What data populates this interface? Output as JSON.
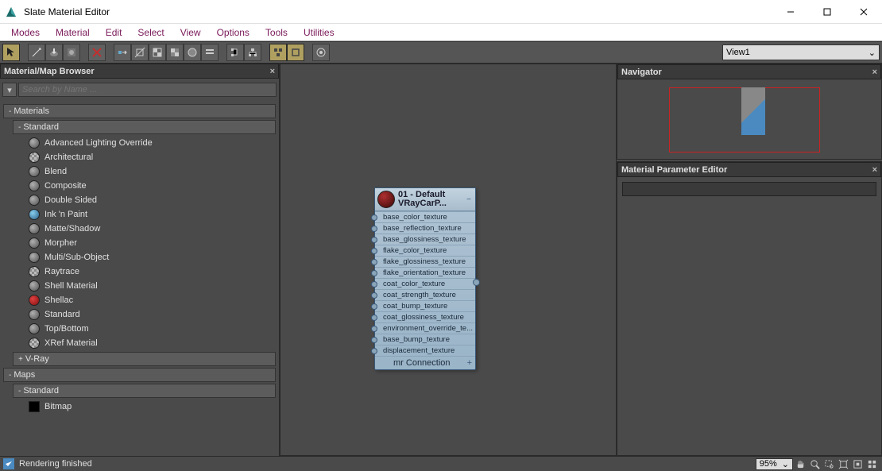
{
  "window": {
    "title": "Slate Material Editor"
  },
  "menu": [
    "Modes",
    "Material",
    "Edit",
    "Select",
    "View",
    "Options",
    "Tools",
    "Utilities"
  ],
  "toolbar": {
    "view_dropdown": "View1"
  },
  "browser": {
    "title": "Material/Map Browser",
    "search_placeholder": "Search by Name ...",
    "cat_materials": "Materials",
    "cat_standard": "Standard",
    "items_standard": [
      {
        "label": "Advanced Lighting Override",
        "swatch": "gray"
      },
      {
        "label": "Architectural",
        "swatch": "checker"
      },
      {
        "label": "Blend",
        "swatch": "gray"
      },
      {
        "label": "Composite",
        "swatch": "gray"
      },
      {
        "label": "Double Sided",
        "swatch": "gray"
      },
      {
        "label": "Ink 'n Paint",
        "swatch": "blue"
      },
      {
        "label": "Matte/Shadow",
        "swatch": "gray"
      },
      {
        "label": "Morpher",
        "swatch": "gray"
      },
      {
        "label": "Multi/Sub-Object",
        "swatch": "gray"
      },
      {
        "label": "Raytrace",
        "swatch": "checker"
      },
      {
        "label": "Shell Material",
        "swatch": "gray"
      },
      {
        "label": "Shellac",
        "swatch": "red"
      },
      {
        "label": "Standard",
        "swatch": "gray"
      },
      {
        "label": "Top/Bottom",
        "swatch": "gray"
      },
      {
        "label": "XRef Material",
        "swatch": "checker"
      }
    ],
    "cat_vray": "V-Ray",
    "cat_maps": "Maps",
    "cat_maps_standard": "Standard",
    "items_maps": [
      {
        "label": "Bitmap",
        "swatch": "black"
      }
    ]
  },
  "node": {
    "title_line1": "01 - Default",
    "title_line2": "VRayCarP...",
    "slots": [
      "base_color_texture",
      "base_reflection_texture",
      "base_glossiness_texture",
      "flake_color_texture",
      "flake_glossiness_texture",
      "flake_orientation_texture",
      "coat_color_texture",
      "coat_strength_texture",
      "coat_bump_texture",
      "coat_glossiness_texture",
      "environment_override_te...",
      "base_bump_texture",
      "displacement_texture"
    ],
    "footer": "mr Connection"
  },
  "navigator": {
    "title": "Navigator"
  },
  "param_editor": {
    "title": "Material Parameter Editor"
  },
  "status": {
    "text": "Rendering finished",
    "zoom": "95%"
  }
}
